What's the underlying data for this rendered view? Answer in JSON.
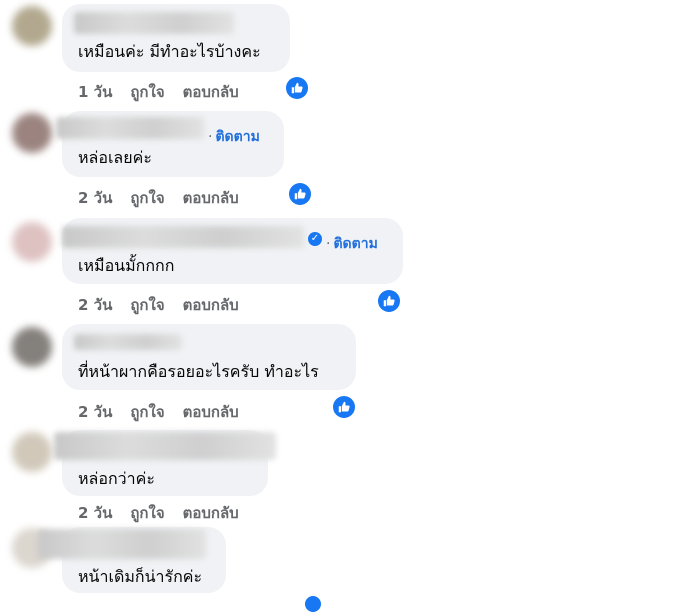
{
  "comments": [
    {
      "text": "เหมือนค่ะ มีทำอะไรบ้างคะ",
      "time": "1 วัน",
      "like": "ถูกใจ",
      "reply": "ตอบกลับ",
      "follow": ""
    },
    {
      "text": "หล่อเลยค่ะ",
      "time": "2 วัน",
      "like": "ถูกใจ",
      "reply": "ตอบกลับ",
      "follow": "ติดตาม"
    },
    {
      "text": "เหมือนมั้กกกก",
      "time": "2 วัน",
      "like": "ถูกใจ",
      "reply": "ตอบกลับ",
      "follow": "ติดตาม"
    },
    {
      "text": "ที่หน้าผากคือรอยอะไรครับ ทำอะไร",
      "time": "2 วัน",
      "like": "ถูกใจ",
      "reply": "ตอบกลับ",
      "follow": ""
    },
    {
      "text": "หล่อกว่าค่ะ",
      "time": "2 วัน",
      "like": "ถูกใจ",
      "reply": "ตอบกลับ",
      "follow": ""
    },
    {
      "text": "หน้าเดิมก็น่ารักค่ะ",
      "time": "",
      "like": "",
      "reply": "",
      "follow": ""
    }
  ],
  "follow_separator": "·",
  "colors": {
    "bubble": "#f0f2f5",
    "link": "#216fdb",
    "meta": "#65676b",
    "like_icon": "#1877f2"
  },
  "icons": {
    "reaction": "thumbs-up-icon",
    "verified": "verified-badge-icon"
  }
}
